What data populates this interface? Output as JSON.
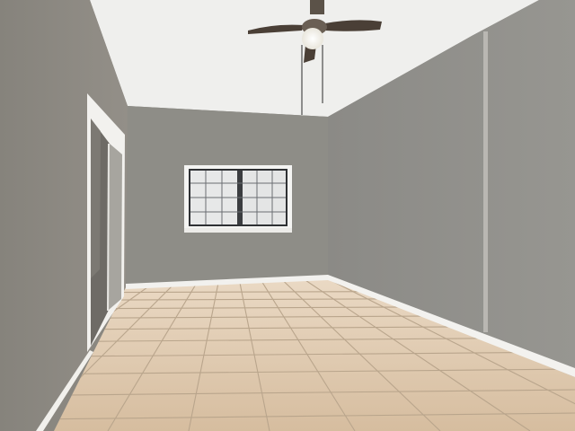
{
  "scene": {
    "description_free": true,
    "colors": {
      "ceiling": "#eeeeec",
      "back_wall": "#8d8c86",
      "left_wall": "#8e8b84",
      "right_wall": "#8f8e8a",
      "baseboard": "#f2f1ee",
      "floor_tile": "#d9c2a6",
      "grout": "#b7a48d",
      "window_frame": "#f4f4f2",
      "fan_blade": "#4a3f36",
      "fan_light": "#fbfbf6",
      "door_glass": "#6f6c66"
    },
    "icons": [
      "ceiling-fan-icon"
    ]
  }
}
